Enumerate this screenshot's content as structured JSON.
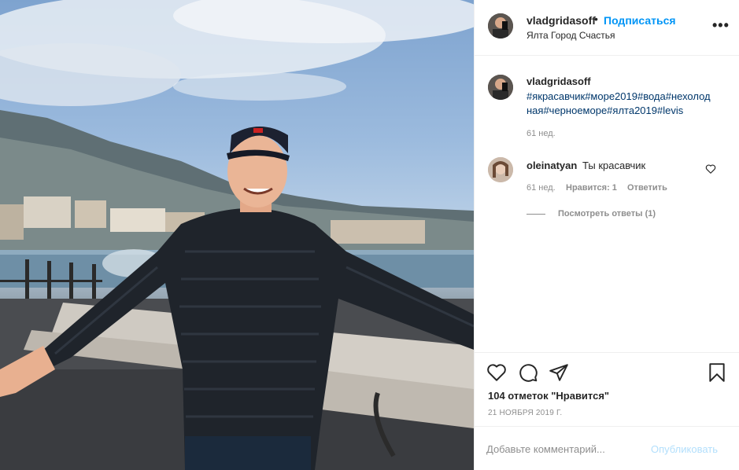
{
  "photo": {
    "description_icon": "post-photo"
  },
  "header": {
    "username": "vladgridasoff",
    "dot": "•",
    "follow": "Подписаться",
    "location": "Ялта Город Счастья",
    "more": "•••"
  },
  "caption": {
    "username": "vladgridasoff",
    "text": "#якрасавчик#море2019#вода#нехолодная#черноеморе#ялта2019#levis",
    "time": "61 нед."
  },
  "comment": {
    "username": "oleinatyan",
    "text": "Ты красавчик",
    "time": "61 нед.",
    "likes": "Нравится: 1",
    "reply": "Ответить",
    "view_replies": "Посмотреть ответы (1)"
  },
  "actions": {
    "likes": "104 отметок \"Нравится\"",
    "date": "21 НОЯБРЯ 2019 Г."
  },
  "add_comment": {
    "placeholder": "Добавьте комментарий...",
    "publish": "Опубликовать"
  },
  "colors": {
    "link": "#0095f6",
    "hashtag": "#00376b",
    "muted": "#8e8e8e",
    "publish_disabled": "#b2dffc"
  }
}
